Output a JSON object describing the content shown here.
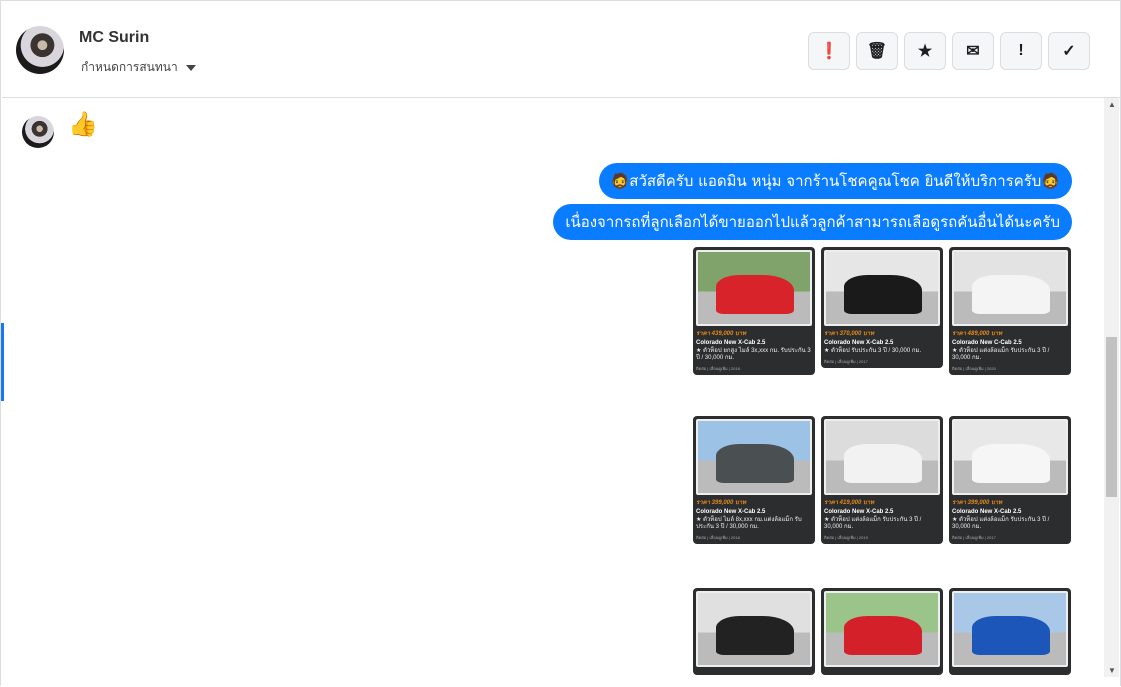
{
  "header": {
    "name": "MC Surin",
    "subtitle": "กำหนดการสนทนา",
    "actions": [
      {
        "icon": "alert-circle-icon",
        "glyph": "❗"
      },
      {
        "icon": "trash-icon",
        "glyph": "🗑"
      },
      {
        "icon": "star-icon",
        "glyph": "★"
      },
      {
        "icon": "mail-icon",
        "glyph": "✉"
      },
      {
        "icon": "exclamation-icon",
        "glyph": "!"
      },
      {
        "icon": "check-icon",
        "glyph": "✓"
      }
    ]
  },
  "messages": {
    "like": "👍",
    "bubble1": "🧔สวัสดีครับ แอดมิน หนุ่ม จากร้านโชคคูณโชค ยินดีให้บริการครับ🧔",
    "bubble2": "เนื่องจากรถที่ลูกเลือกได้ขายออกไปแล้วลูกค้าสามารถเลือดูรถคันอื่นได้นะครับ"
  },
  "cards": [
    {
      "price": "ราคา 439,000 บาท",
      "title": "Colorado New X-Cab 2.5",
      "feature": "★ ตัวท็อป ยกสูง ไมล์ 3x,xxx กม. รับประกัน 3 ปี / 30,000 กม.",
      "meta": "ติดต่อ | เลื่อนดูเพิ่ม | 2018",
      "color": "#d8232a",
      "bg": "#7fa36a"
    },
    {
      "price": "ราคา 370,000 บาท",
      "title": "Colorado New X-Cab 2.5",
      "feature": "★ ตัวท็อป รับประกัน 3 ปี / 30,000 กม.",
      "meta": "ติดต่อ | เลื่อนดูเพิ่ม | 2017",
      "color": "#1a1a1a",
      "bg": "#e6e6e6"
    },
    {
      "price": "ราคา 489,000 บาท",
      "title": "Colorado New C-Cab 2.5",
      "feature": "★ ตัวท็อป แต่งล้อแม็ก รับประกัน 3 ปี / 30,000 กม.",
      "meta": "ติดต่อ | เลื่อนดูเพิ่ม | 2020",
      "color": "#f4f4f4",
      "bg": "#e3e3e3"
    },
    {
      "price": "ราคา 399,000 บาท",
      "title": "Colorado New X-Cab 2.5",
      "feature": "★ ตัวท็อป ไมล์ 8x,xxx กม.แต่งล้อแม็ก รับประกัน 3 ปี / 30,000 กม.",
      "meta": "ติดต่อ | เลื่อนดูเพิ่ม | 2018",
      "color": "#4a4f52",
      "bg": "#9cc2e6"
    },
    {
      "price": "ราคา 419,000 บาท",
      "title": "Colorado New X-Cab 2.5",
      "feature": "★ ตัวท็อป แต่งล้อแม็ก รับประกัน 3 ปี / 30,000 กม.",
      "meta": "ติดต่อ | เลื่อนดูเพิ่ม | 2019",
      "color": "#f2f2f2",
      "bg": "#dcdcdc"
    },
    {
      "price": "ราคา 399,000 บาท",
      "title": "Colorado New X-Cab 2.5",
      "feature": "★ ตัวท็อป แต่งล้อแม็ก รับประกัน 3 ปี / 30,000 กม.",
      "meta": "ติดต่อ | เลื่อนดูเพิ่ม | 2017",
      "color": "#f6f6f6",
      "bg": "#e8e8e8"
    },
    {
      "price": "",
      "title": "",
      "feature": "",
      "meta": "",
      "color": "#222",
      "bg": "#e0e0e0"
    },
    {
      "price": "",
      "title": "",
      "feature": "",
      "meta": "",
      "color": "#d42028",
      "bg": "#9bc48a"
    },
    {
      "price": "",
      "title": "",
      "feature": "",
      "meta": "",
      "color": "#1c56b8",
      "bg": "#a9c8e8"
    }
  ]
}
